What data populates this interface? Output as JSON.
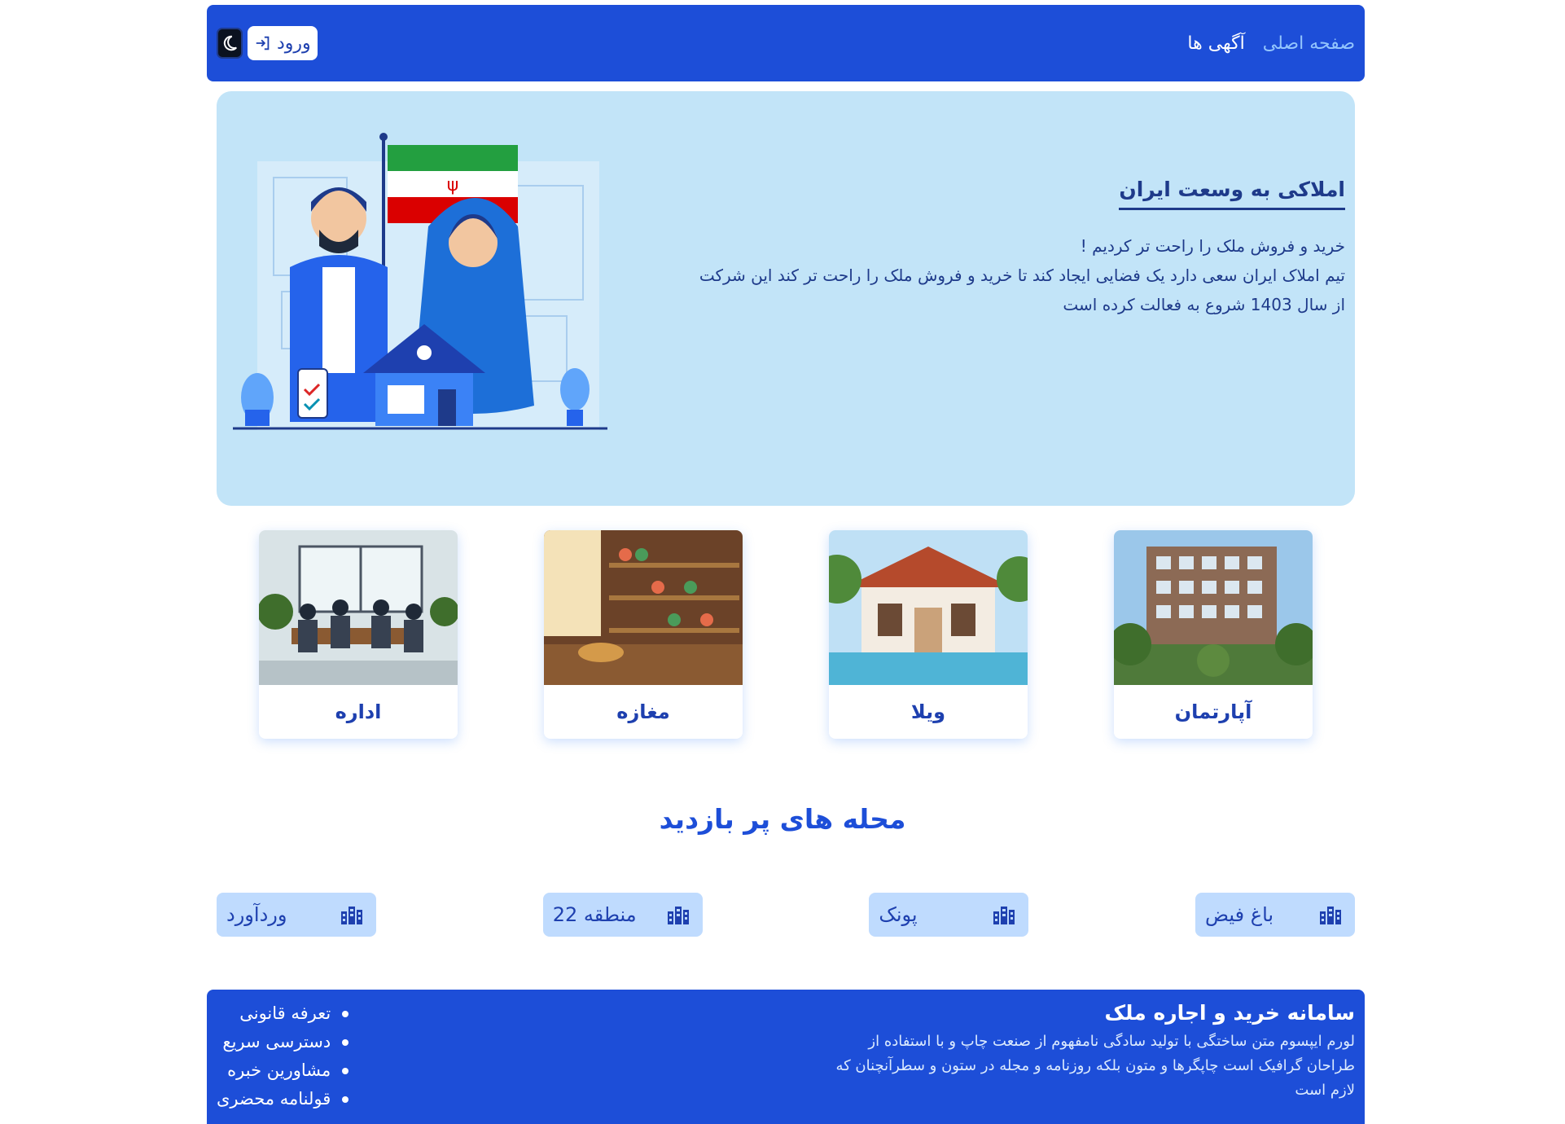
{
  "nav": {
    "links": [
      "صفحه اصلی",
      "آگهی ها"
    ],
    "login_label": "ورود",
    "theme_icon": "moon-icon",
    "login_icon": "sign-in-icon"
  },
  "hero": {
    "title": "املاکی به وسعت ایران",
    "lines": [
      "خرید و فروش ملک را راحت تر کردیم !",
      "تیم املاک ایران سعی دارد یک فضایی ایجاد کند تا خرید و فروش ملک را راحت تر کند این شرکت",
      "از سال 1403 شروع به فعالت کرده است"
    ]
  },
  "categories": [
    "آپارتمان",
    "ویلا",
    "مغازه",
    "اداره"
  ],
  "popular": {
    "title": "محله های پر بازدید",
    "areas": [
      "باغ فیض",
      "پونک",
      "منطقه 22",
      "وردآورد"
    ],
    "icon": "buildings-icon"
  },
  "footer": {
    "title": "سامانه خرید و اجاره ملک",
    "description": [
      "لورم ایپسوم متن ساختگی با تولید سادگی نامفهوم از صنعت چاپ و با استفاده از",
      "طراحان گرافیک است چاپگرها و متون بلکه روزنامه و مجله در ستون و سطرآنچنان که",
      "لازم است"
    ],
    "links": [
      "تعرفه قانونی",
      "دسترسی سریع",
      "مشاورین خبره",
      "قولنامه محضری"
    ]
  },
  "colors": {
    "primary": "#1d4ed8",
    "hero_bg": "#c2e4f8",
    "chip_bg": "#bfdbfe",
    "text_dark": "#1e3a8a"
  }
}
